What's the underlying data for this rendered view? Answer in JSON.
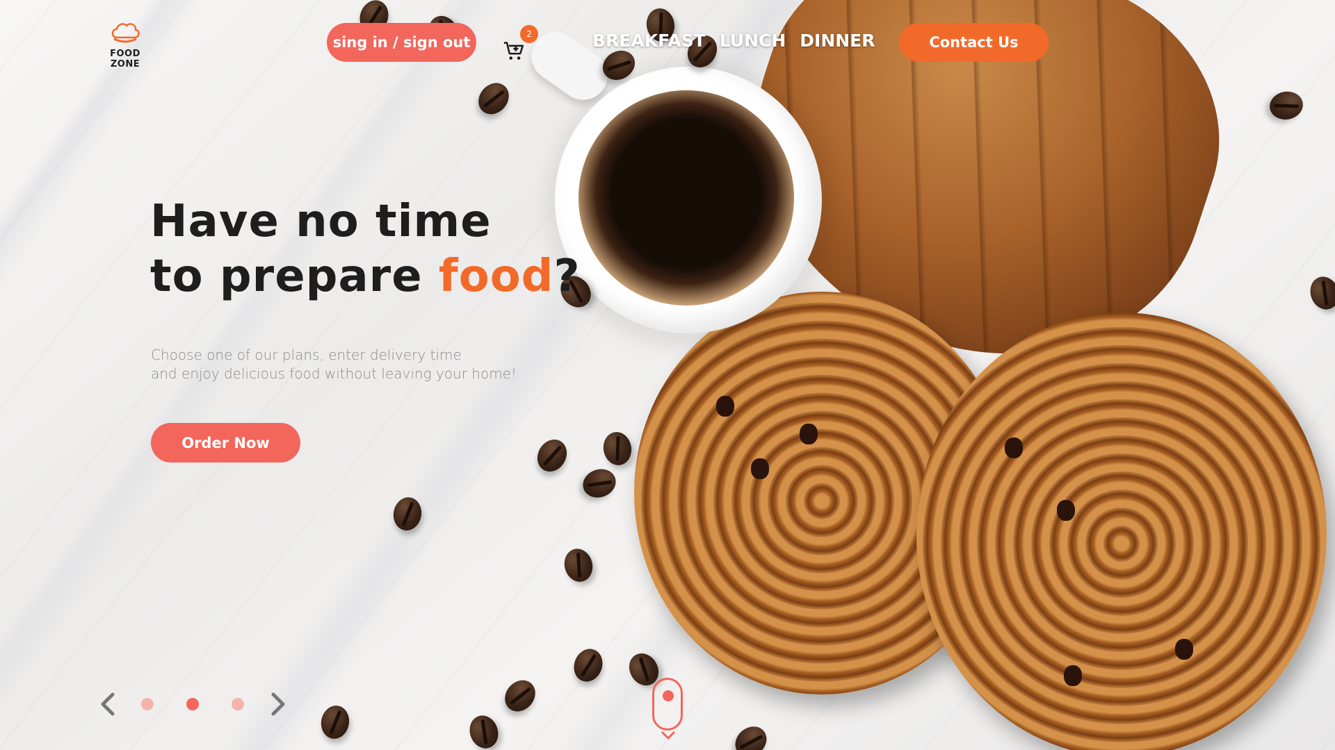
{
  "brand": {
    "name": "FOOD ZONE"
  },
  "header": {
    "auth_label": "sing in / sign out",
    "cart_count": "2",
    "nav": [
      "BREAKFAST",
      "LUNCH",
      "DINNER"
    ],
    "contact_label": "Contact Us"
  },
  "hero": {
    "title_line1": "Have no time",
    "title_line2_start": "to prepare ",
    "title_line2_accent": "food",
    "title_line2_end": "?",
    "sub_line1": "Choose one of our plans, enter delivery time",
    "sub_line2": "and enjoy delicious food without leaving your home!",
    "order_label": "Order Now"
  },
  "slider": {
    "total": 3,
    "active_index": 1
  },
  "colors": {
    "accent": "#f26a2a",
    "button": "#f2665c",
    "text": "#1e1e1e"
  },
  "icons": [
    "chef-hat-icon",
    "cart-icon",
    "chevron-left-icon",
    "chevron-right-icon",
    "scroll-mouse-icon",
    "chevron-down-icon"
  ]
}
